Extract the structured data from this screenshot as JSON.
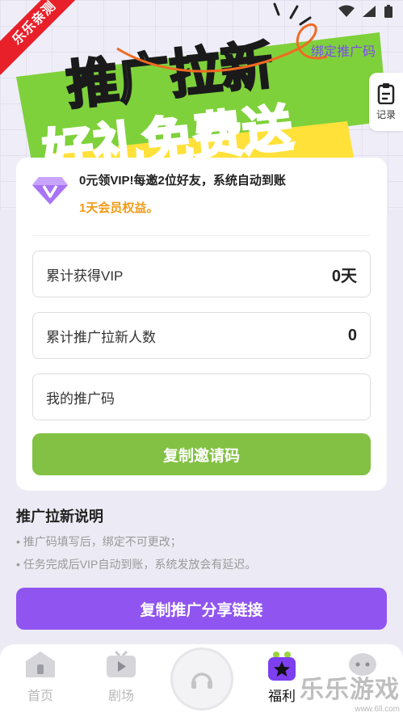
{
  "corner_badge": "乐乐亲测",
  "hero": {
    "title_line1": "推广拉新",
    "title_line2": "好礼免费送",
    "bind_link": "绑定推广码",
    "record_label": "记录"
  },
  "vip": {
    "icon": "diamond-v-icon",
    "line1": "0元领VIP!每邀2位好友，系统自动到账",
    "line2": "1天会员权益。"
  },
  "fields": [
    {
      "label": "累计获得VIP",
      "value": "0天"
    },
    {
      "label": "累计推广拉新人数",
      "value": "0"
    },
    {
      "label": "我的推广码",
      "value": ""
    }
  ],
  "copy_invite_button": "复制邀请码",
  "rules": {
    "title": "推广拉新说明",
    "items": [
      "• 推广码填写后，绑定不可更改；",
      "• 任务完成后VIP自动到账，系统发放会有延迟。"
    ]
  },
  "share_button": "复制推广分享链接",
  "tabbar": {
    "tabs": [
      {
        "label": "首页",
        "icon": "home-icon",
        "active": false
      },
      {
        "label": "剧场",
        "icon": "tv-icon",
        "active": false
      },
      {
        "label": "福利",
        "icon": "star-gift-icon",
        "active": true
      },
      {
        "label": "",
        "icon": "chat-icon",
        "active": false
      }
    ]
  },
  "watermark": {
    "main": "乐乐游戏",
    "sub": "www.6ll.com"
  },
  "colors": {
    "accent_purple": "#9055f0",
    "accent_green": "#82c143",
    "orange": "#f29a14",
    "hero_green": "#7fd13b",
    "hero_yellow": "#ffe13a"
  }
}
